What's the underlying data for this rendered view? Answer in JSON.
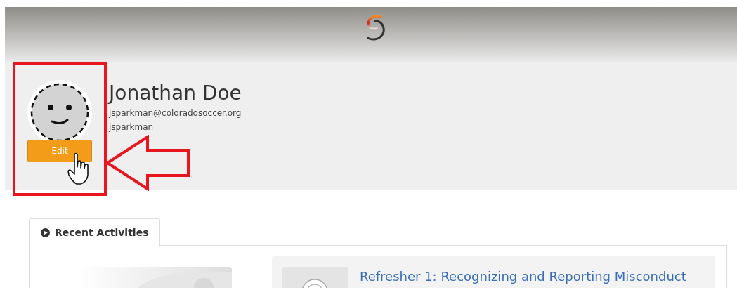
{
  "profile": {
    "name": "Jonathan Doe",
    "email": "jsparkman@coloradosoccer.org",
    "username": "jsparkman",
    "edit_button": "Edit"
  },
  "tabs": [
    {
      "label": "Recent Activities",
      "selected": true
    }
  ],
  "activities": [
    {
      "title": "Refresher 1: Recognizing and Reporting Misconduct"
    }
  ]
}
